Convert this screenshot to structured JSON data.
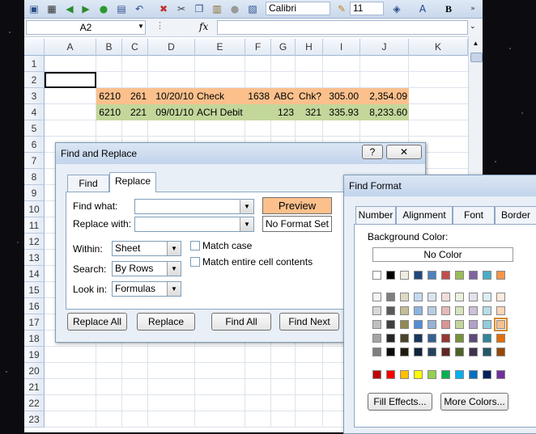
{
  "toolbar": {
    "font_name": "Calibri",
    "font_size": "11",
    "bold_label": "B"
  },
  "formula_bar": {
    "name_box": "A2",
    "fx_label": "fx",
    "formula": ""
  },
  "sheet": {
    "columns": [
      "A",
      "B",
      "C",
      "D",
      "E",
      "F",
      "G",
      "H",
      "I",
      "J",
      "K"
    ],
    "rows": [
      "1",
      "2",
      "3",
      "4",
      "5",
      "6",
      "7",
      "8",
      "9",
      "10",
      "11",
      "12",
      "13",
      "14",
      "15",
      "16",
      "17",
      "18",
      "19",
      "20",
      "21",
      "22",
      "23"
    ],
    "row3": {
      "B": "6210",
      "C": "261",
      "D": "10/20/10",
      "E": "Check",
      "F": "1638",
      "G": "ABC",
      "H": "Chk?",
      "I": "305.00",
      "J": "2,354.09"
    },
    "row4": {
      "B": "6210",
      "C": "221",
      "D": "09/01/10",
      "E": "ACH Debit",
      "G": "123",
      "H": "321",
      "I": "335.93",
      "J": "8,233.60"
    },
    "row3_color": "#fbc08c",
    "row4_color": "#c3d79b"
  },
  "find_replace": {
    "title": "Find and Replace",
    "help_label": "?",
    "close_label": "✕",
    "tabs": [
      "Find",
      "Replace"
    ],
    "active_tab": "Replace",
    "find_what_label": "Find what:",
    "replace_with_label": "Replace with:",
    "find_what_value": "",
    "replace_with_value": "",
    "preview_label": "Preview",
    "preview_color": "#fbc08c",
    "no_format_label": "No Format Set",
    "within_label": "Within:",
    "within_value": "Sheet",
    "search_label": "Search:",
    "search_value": "By Rows",
    "look_in_label": "Look in:",
    "look_in_value": "Formulas",
    "match_case_label": "Match case",
    "match_entire_label": "Match entire cell contents",
    "buttons": {
      "replace_all": "Replace All",
      "replace": "Replace",
      "find_all": "Find All",
      "find_next": "Find Next"
    }
  },
  "find_format": {
    "title": "Find Format",
    "tabs": [
      "Number",
      "Alignment",
      "Font",
      "Border"
    ],
    "bg_color_label": "Background Color:",
    "no_color_label": "No Color",
    "fill_effects_label": "Fill Effects...",
    "more_colors_label": "More Colors...",
    "palette_top": [
      "#ffffff",
      "#000000",
      "#eeece1",
      "#1f497d",
      "#4f81bd",
      "#c0504d",
      "#9bbb59",
      "#8064a2",
      "#4bacc6",
      "#f79646"
    ],
    "palette_shades": [
      [
        "#f2f2f2",
        "#7f7f7f",
        "#ddd9c3",
        "#c6d9f0",
        "#dbe5f1",
        "#f2dcdb",
        "#ebf1dd",
        "#e5e0ec",
        "#dbeef3",
        "#fdeada"
      ],
      [
        "#d8d8d8",
        "#595959",
        "#c4bd97",
        "#8db3e2",
        "#b8cce4",
        "#e5b9b7",
        "#d7e3bc",
        "#ccc1d9",
        "#b7dde8",
        "#fbd5b5"
      ],
      [
        "#bfbfbf",
        "#3f3f3f",
        "#938953",
        "#548dd4",
        "#95b3d7",
        "#d99694",
        "#c3d69b",
        "#b2a2c7",
        "#92cddc",
        "#fac08f"
      ],
      [
        "#a5a5a5",
        "#262626",
        "#494429",
        "#17365d",
        "#366092",
        "#953734",
        "#76923c",
        "#5f497a",
        "#31859b",
        "#e36c09"
      ],
      [
        "#7f7f7f",
        "#0c0c0c",
        "#1d1b10",
        "#0f243e",
        "#244061",
        "#632423",
        "#4f6128",
        "#3f3151",
        "#205867",
        "#974806"
      ]
    ],
    "palette_standard": [
      "#c00000",
      "#ff0000",
      "#ffc000",
      "#ffff00",
      "#92d050",
      "#00b050",
      "#00b0f0",
      "#0070c0",
      "#002060",
      "#7030a0"
    ],
    "selected_color": "#fac08f"
  }
}
